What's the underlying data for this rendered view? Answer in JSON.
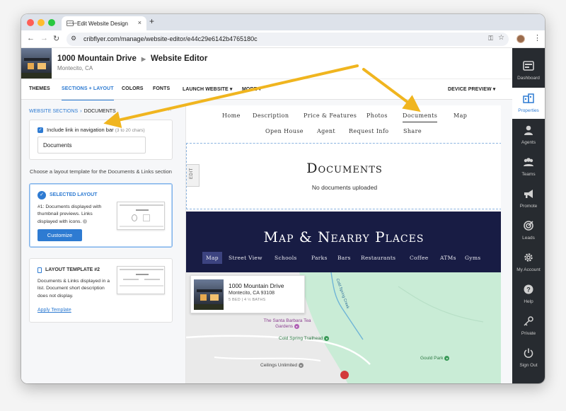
{
  "browser": {
    "tab_title": "Edit Website Design",
    "favicon_text": "cribflyer",
    "new_tab": "+",
    "close": "×",
    "back": "←",
    "forward": "→",
    "reload": "↻",
    "url": "cribflyer.com/manage/website-editor/e44c29e6142b4765180c"
  },
  "property": {
    "title": "1000 Mountain Drive",
    "section": "Website Editor",
    "location": "Montecito, CA"
  },
  "editor_tabs": [
    {
      "label": "THEMES"
    },
    {
      "label": "SECTIONS + LAYOUT"
    },
    {
      "label": "COLORS"
    },
    {
      "label": "FONTS"
    },
    {
      "label": "LAUNCH WEBSITE ▾"
    },
    {
      "label": "MORE ▾"
    },
    {
      "label": "DEVICE PREVIEW ▾"
    }
  ],
  "panel": {
    "breadcrumb_link": "WEBSITE SECTIONS",
    "breadcrumb_sep": "›",
    "breadcrumb_current": "DOCUMENTS",
    "close": "×",
    "include_label": "Include link in navigation bar",
    "include_hint": "(3 to 20 chars)",
    "nav_value": "Documents",
    "choose_text": "Choose a layout template for the Documents & Links section",
    "selected": {
      "title": "SELECTED LAYOUT",
      "desc": "#1: Documents displayed with thumbnail previews. Links displayed with icons.",
      "button": "Customize"
    },
    "template2": {
      "title": "LAYOUT TEMPLATE #2",
      "desc": "Documents & Links displayed in a list. Document short description does not display.",
      "link": "Apply Template"
    }
  },
  "site": {
    "nav_row1": [
      "Home",
      "Description",
      "Price & Features",
      "Photos",
      "Documents",
      "Map"
    ],
    "nav_row2": [
      "Open House",
      "Agent",
      "Request Info",
      "Share"
    ],
    "edit_label": "EDIT",
    "docs_title": "Documents",
    "docs_empty": "No documents uploaded",
    "map_title": "Map & Nearby Places",
    "map_tabs": [
      "Map",
      "Street View",
      "Schools",
      "Parks",
      "Bars",
      "Restaurants",
      "Coffee",
      "ATMs",
      "Gyms"
    ],
    "map_card": {
      "name": "1000 Mountain Drive",
      "address": "Montecito, CA 93108",
      "beds": "5 BED | 4 ½ BATHS"
    },
    "pois": [
      {
        "name": "The Santa Barbara Tea Gardens"
      },
      {
        "name": "Cold Spring Trailhead"
      },
      {
        "name": "Gould Park"
      },
      {
        "name": "Ceilings Unlimited"
      }
    ],
    "map_road_label": "Cold Spring Creek"
  },
  "rail": [
    {
      "label": "Dashboard",
      "icon": "dashboard-icon"
    },
    {
      "label": "Properties",
      "icon": "properties-icon",
      "active": true
    },
    {
      "label": "Agents",
      "icon": "agents-icon"
    },
    {
      "label": "Teams",
      "icon": "teams-icon"
    },
    {
      "label": "Promote",
      "icon": "megaphone-icon"
    },
    {
      "label": "Leads",
      "icon": "target-icon"
    },
    {
      "label": "My Account",
      "icon": "gear-icon"
    },
    {
      "label": "Help",
      "icon": "help-icon"
    },
    {
      "label": "Private",
      "icon": "key-icon"
    },
    {
      "label": "Sign Out",
      "icon": "power-icon"
    }
  ],
  "colors": {
    "accent": "#2e7bd2",
    "rail_bg": "#272b30",
    "map_header_bg": "#181c44",
    "arrow": "#f0b51f"
  }
}
